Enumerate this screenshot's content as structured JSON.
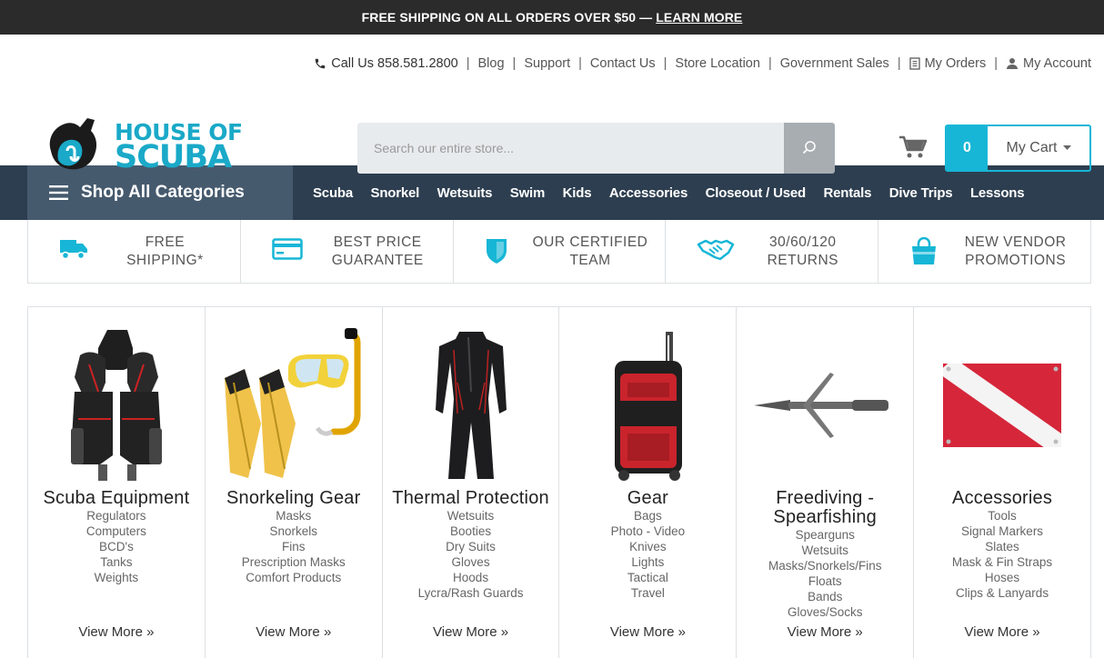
{
  "promo": {
    "text": "FREE SHIPPING ON ALL ORDERS OVER $50 —",
    "link": "LEARN MORE"
  },
  "utility": {
    "phone": "Call Us 858.581.2800",
    "links": [
      "Blog",
      "Support",
      "Contact Us",
      "Store Location",
      "Government Sales"
    ],
    "orders": "My Orders",
    "account": "My Account"
  },
  "logo": {
    "line1": "HOUSE OF",
    "line2": "SCUBA"
  },
  "search": {
    "placeholder": "Search our entire store..."
  },
  "cart": {
    "count": "0",
    "label": "My Cart"
  },
  "nav": {
    "shop_all": "Shop All Categories",
    "links": [
      "Scuba",
      "Snorkel",
      "Wetsuits",
      "Swim",
      "Kids",
      "Accessories",
      "Closeout / Used",
      "Rentals",
      "Dive Trips",
      "Lessons"
    ]
  },
  "features": [
    {
      "line1": "FREE",
      "line2": "SHIPPING*",
      "icon": "truck-icon"
    },
    {
      "line1": "BEST PRICE",
      "line2": "GUARANTEE",
      "icon": "credit-card-icon"
    },
    {
      "line1": "OUR CERTIFIED",
      "line2": "TEAM",
      "icon": "shield-icon"
    },
    {
      "line1": "30/60/120",
      "line2": "RETURNS",
      "icon": "handshake-icon"
    },
    {
      "line1": "NEW VENDOR",
      "line2": "PROMOTIONS",
      "icon": "shopping-bag-icon"
    }
  ],
  "categories": [
    {
      "title": "Scuba Equipment",
      "items": [
        "Regulators",
        "Computers",
        "BCD's",
        "Tanks",
        "Weights"
      ],
      "more": "View More »"
    },
    {
      "title": "Snorkeling Gear",
      "items": [
        "Masks",
        "Snorkels",
        "Fins",
        "Prescription Masks",
        "Comfort Products"
      ],
      "more": "View More »"
    },
    {
      "title": "Thermal Protection",
      "items": [
        "Wetsuits",
        "Booties",
        "Dry Suits",
        "Gloves",
        "Hoods",
        "Lycra/Rash Guards"
      ],
      "more": "View More »"
    },
    {
      "title": "Gear",
      "items": [
        "Bags",
        "Photo - Video",
        "Knives",
        "Lights",
        "Tactical",
        "Travel"
      ],
      "more": "View More »"
    },
    {
      "title": "Freediving - Spearfishing",
      "items": [
        "Spearguns",
        "Wetsuits",
        "Masks/Snorkels/Fins",
        "Floats",
        "Bands",
        "Gloves/Socks"
      ],
      "more": "View More »"
    },
    {
      "title": "Accessories",
      "items": [
        "Tools",
        "Signal Markers",
        "Slates",
        "Mask & Fin Straps",
        "Hoses",
        "Clips & Lanyards"
      ],
      "more": "View More »"
    }
  ],
  "colors": {
    "accent": "#17b6d6",
    "nav_bg": "#2d3e50",
    "shop_bg": "#465a6e",
    "promo_bg": "#2b2b2b"
  }
}
